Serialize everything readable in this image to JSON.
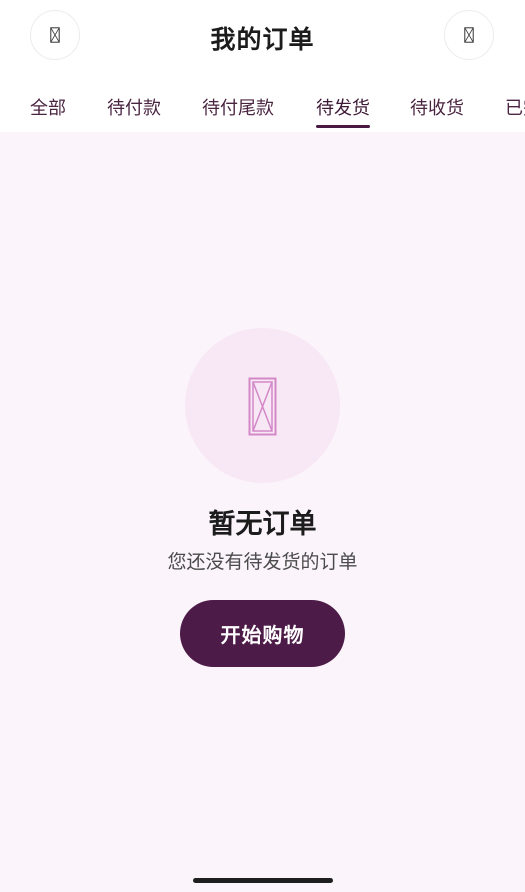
{
  "header": {
    "title": "我的订单",
    "left_icon": "missing-glyph-icon",
    "right_icon": "missing-glyph-icon"
  },
  "tabs": [
    {
      "label": "全部",
      "active": false
    },
    {
      "label": "待付款",
      "active": false
    },
    {
      "label": "待付尾款",
      "active": false
    },
    {
      "label": "待发货",
      "active": true
    },
    {
      "label": "待收货",
      "active": false
    },
    {
      "label": "已完成",
      "active": false
    }
  ],
  "empty_state": {
    "icon": "missing-image-icon",
    "title": "暂无订单",
    "subtitle": "您还没有待发货的订单",
    "button_label": "开始购物"
  },
  "colors": {
    "background": "#fbf4fb",
    "header_bg": "#ffffff",
    "accent": "#4d1b48",
    "icon_circle": "#f8e7f5",
    "icon_stroke": "#d388c8",
    "tab_text": "#4a2541"
  }
}
